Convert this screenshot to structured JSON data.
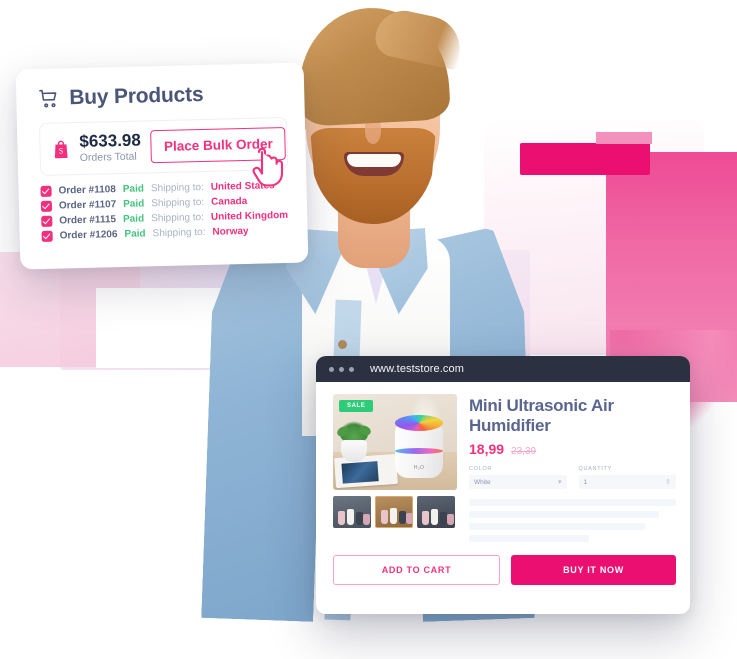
{
  "buy_card": {
    "title": "Buy Products",
    "cart_icon": "shopping-cart-icon",
    "total": {
      "bag_icon": "shopify-bag-icon",
      "amount": "$633.98",
      "label": "Orders Total"
    },
    "bulk_button": "Place Bulk Order",
    "cursor_icon": "pointing-hand-cursor-icon",
    "shipping_prefix": "Shipping to:",
    "orders": [
      {
        "id": "Order #1108",
        "status": "Paid",
        "country": "United States"
      },
      {
        "id": "Order #1107",
        "status": "Paid",
        "country": "Canada"
      },
      {
        "id": "Order #1115",
        "status": "Paid",
        "country": "United Kingdom"
      },
      {
        "id": "Order #1206",
        "status": "Paid",
        "country": "Norway"
      }
    ]
  },
  "store_window": {
    "url": "www.teststore.com",
    "sale_badge": "SALE",
    "product": {
      "title": "Mini Ultrasonic Air Humidifier",
      "price": "18,99",
      "compare_at_price": "23,39",
      "brand_mark": "H₂O"
    },
    "options": [
      {
        "label": "COLOR",
        "value": "White",
        "control": "select",
        "caret": "▾"
      },
      {
        "label": "QUANTITY",
        "value": "1",
        "control": "stepper",
        "caret": "⇳"
      }
    ],
    "actions": {
      "add_to_cart": "ADD TO CART",
      "buy_it_now": "BUY IT NOW"
    }
  },
  "colors": {
    "accent_pink": "#f4307e",
    "accent_pink_strong": "#ec0f72",
    "paid_green": "#43c37e",
    "sale_green": "#2ecc78",
    "title_navy": "#4a5578",
    "browser_bar": "#2b3140"
  }
}
